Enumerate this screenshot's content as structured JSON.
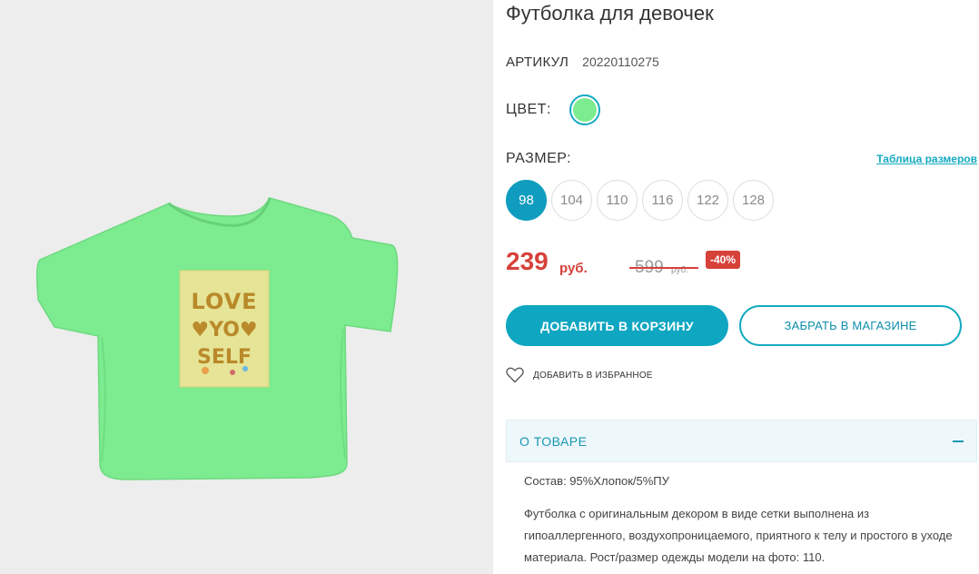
{
  "product": {
    "title": "Футболка для девочек",
    "sku_label": "АРТИКУЛ",
    "sku_value": "20220110275",
    "shirt_print_text": "LOVE YO SELF"
  },
  "color": {
    "label": "ЦВЕТ:",
    "selected_hex": "#7deb8f"
  },
  "size": {
    "label": "РАЗМЕР:",
    "table_link": "Таблица размеров",
    "options": [
      "98",
      "104",
      "110",
      "116",
      "122",
      "128"
    ],
    "selected": "98"
  },
  "price": {
    "current": "239",
    "currency": "руб.",
    "old": "599",
    "old_currency": "руб.",
    "discount": "-40%"
  },
  "actions": {
    "add_to_cart": "ДОБАВИТЬ В КОРЗИНУ",
    "pickup_in_store": "ЗАБРАТЬ В МАГАЗИНЕ",
    "add_to_favorites": "ДОБАВИТЬ В ИЗБРАННОЕ"
  },
  "about": {
    "title": "О ТОВАРЕ",
    "composition": "Состав: 95%Хлопок/5%ПУ",
    "description": "Футболка с оригинальным декором в виде сетки выполнена из гипоаллергенного, воздухопроницаемого, приятного к телу и простого в уходе материала. Рост/размер одежды модели на фото: 110."
  },
  "colors": {
    "accent": "#14aac1",
    "button": "#0fa6c2",
    "price_red": "#d6413a",
    "shirt_green": "#7deb8f",
    "print_yellow": "#e6e496"
  }
}
